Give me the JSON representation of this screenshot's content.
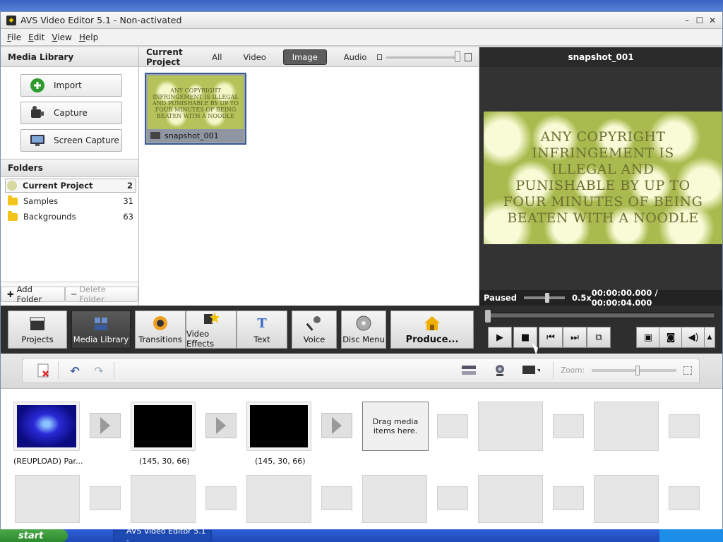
{
  "app": {
    "title": "AVS Video Editor 5.1 - Non-activated"
  },
  "menu": [
    "File",
    "Edit",
    "View",
    "Help"
  ],
  "library": {
    "header": "Media Library",
    "buttons": {
      "import": "Import",
      "capture": "Capture",
      "screen_capture": "Screen Capture"
    },
    "folders_header": "Folders",
    "folders": [
      {
        "name": "Current Project",
        "count": "2"
      },
      {
        "name": "Samples",
        "count": "31"
      },
      {
        "name": "Backgrounds",
        "count": "63"
      }
    ],
    "add_folder": "Add Folder",
    "delete_folder": "Delete Folder"
  },
  "project": {
    "header": "Current Project",
    "filters": {
      "all": "All",
      "video": "Video",
      "image": "Image",
      "audio": "Audio"
    },
    "active_filter": "Image",
    "item": {
      "name": "snapshot_001",
      "text": "ANY COPYRIGHT INFRINGEMENT IS ILLEGAL AND PUNISHABLE BY UP TO FOUR MINUTES OF BEING BEATEN WITH A NOODLE"
    }
  },
  "preview": {
    "title": "snapshot_001",
    "text": "ANY COPYRIGHT INFRINGEMENT IS ILLEGAL AND PUNISHABLE BY UP TO FOUR MINUTES OF BEING BEATEN WITH A NOODLE",
    "state": "Paused",
    "speed": "0.5x",
    "time": "00:00:00.000 / 00:00:04.000"
  },
  "toolbar": {
    "projects": "Projects",
    "media_library": "Media Library",
    "transitions": "Transitions",
    "video_effects": "Video Effects",
    "text": "Text",
    "voice": "Voice",
    "disc_menu": "Disc Menu",
    "produce": "Produce..."
  },
  "timeline": {
    "zoom_label": "Zoom:",
    "clips": [
      {
        "label": "(REUPLOAD) Par..."
      },
      {
        "label": "(145, 30, 66)"
      },
      {
        "label": "(145, 30, 66)"
      }
    ],
    "drop_hint": "Drag media items here."
  },
  "taskbar": {
    "start": "start",
    "task": "AVS Video Editor 5.1 -"
  },
  "colors": {
    "accent": "#3a5a96",
    "toolbar_bg": "#2e2e2e",
    "preview_bg": "#a9bb4e",
    "active_tool": "#4a4a4a"
  }
}
